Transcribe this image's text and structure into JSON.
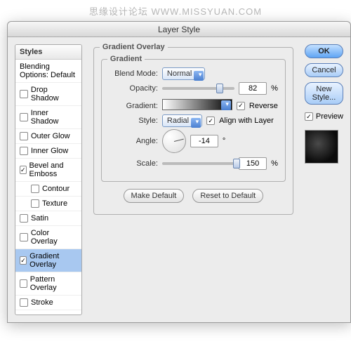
{
  "watermark": "思缘设计论坛   WWW.MISSYUAN.COM",
  "window": {
    "title": "Layer Style"
  },
  "sidebar": {
    "header": "Styles",
    "blending_label": "Blending Options: Default",
    "items": [
      {
        "label": "Drop Shadow",
        "checked": false,
        "indent": false
      },
      {
        "label": "Inner Shadow",
        "checked": false,
        "indent": false
      },
      {
        "label": "Outer Glow",
        "checked": false,
        "indent": false
      },
      {
        "label": "Inner Glow",
        "checked": false,
        "indent": false
      },
      {
        "label": "Bevel and Emboss",
        "checked": true,
        "indent": false
      },
      {
        "label": "Contour",
        "checked": false,
        "indent": true
      },
      {
        "label": "Texture",
        "checked": false,
        "indent": true
      },
      {
        "label": "Satin",
        "checked": false,
        "indent": false
      },
      {
        "label": "Color Overlay",
        "checked": false,
        "indent": false
      },
      {
        "label": "Gradient Overlay",
        "checked": true,
        "indent": false,
        "selected": true
      },
      {
        "label": "Pattern Overlay",
        "checked": false,
        "indent": false
      },
      {
        "label": "Stroke",
        "checked": false,
        "indent": false
      }
    ]
  },
  "panel": {
    "group_title": "Gradient Overlay",
    "sub_title": "Gradient",
    "labels": {
      "blend_mode": "Blend Mode:",
      "opacity": "Opacity:",
      "gradient": "Gradient:",
      "style": "Style:",
      "angle": "Angle:",
      "scale": "Scale:",
      "reverse": "Reverse",
      "align": "Align with Layer",
      "pct": "%",
      "deg": "°"
    },
    "values": {
      "blend_mode": "Normal",
      "opacity": "82",
      "style": "Radial",
      "angle": "-14",
      "scale": "150",
      "reverse": true,
      "align": true,
      "opacity_pos": "75%",
      "scale_pos": "98%"
    },
    "buttons": {
      "make_default": "Make Default",
      "reset": "Reset to Default"
    }
  },
  "right": {
    "ok": "OK",
    "cancel": "Cancel",
    "new_style": "New Style...",
    "preview_label": "Preview",
    "preview_checked": true
  },
  "chart_data": {
    "type": "table",
    "title": "Layer Style — Gradient Overlay settings",
    "rows": [
      [
        "Blend Mode",
        "Normal"
      ],
      [
        "Opacity",
        "82 %"
      ],
      [
        "Gradient",
        "white → black"
      ],
      [
        "Reverse",
        "true"
      ],
      [
        "Style",
        "Radial"
      ],
      [
        "Align with Layer",
        "true"
      ],
      [
        "Angle",
        "-14 °"
      ],
      [
        "Scale",
        "150 %"
      ]
    ]
  }
}
